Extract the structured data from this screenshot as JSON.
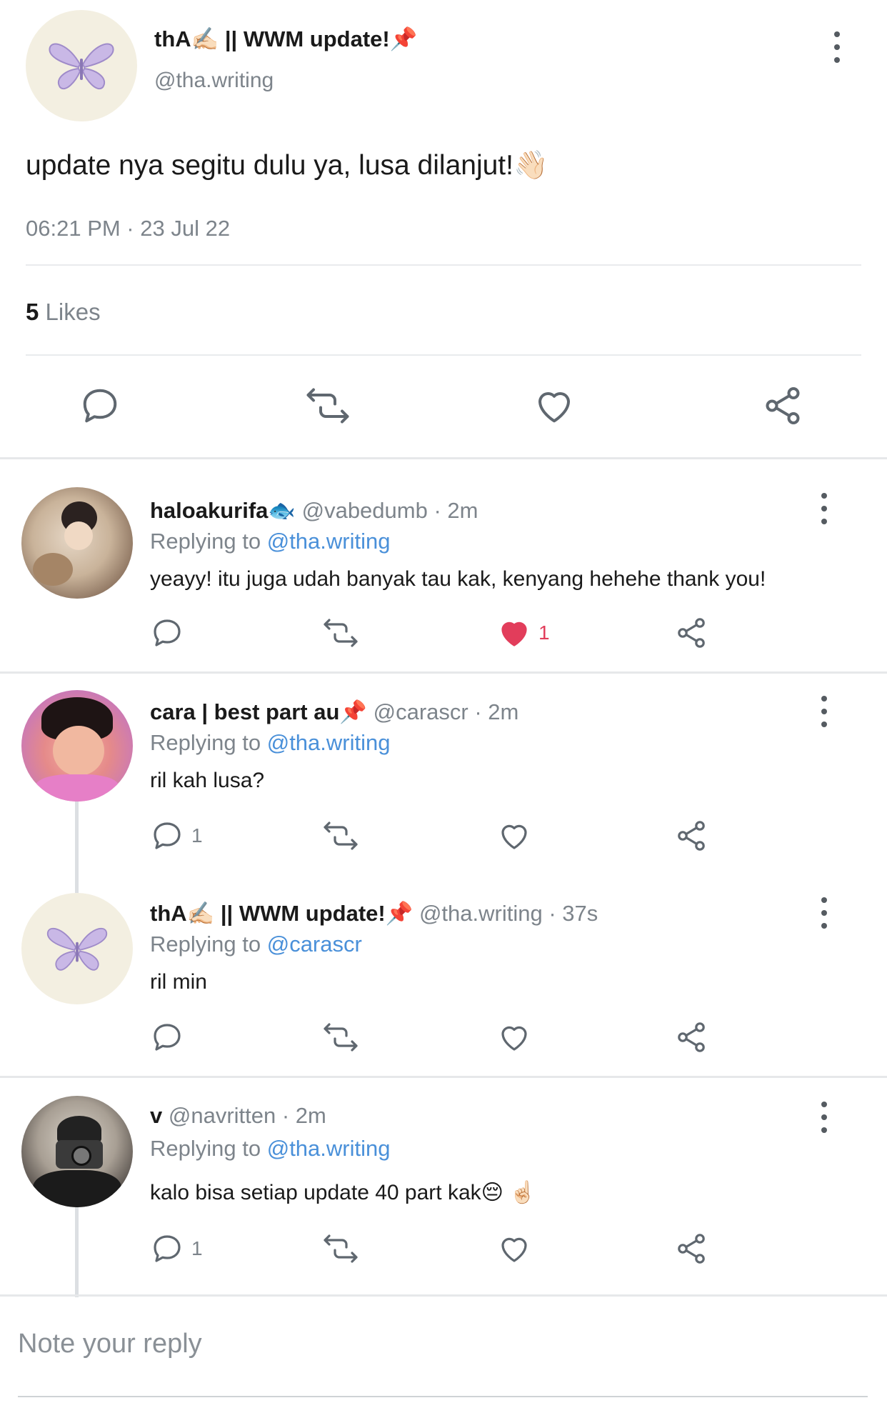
{
  "main_post": {
    "author_name": "thA✍🏻 || WWM update!📌",
    "handle": "@tha.writing",
    "text": "update nya segitu dulu ya, lusa dilanjut!👋🏻",
    "timestamp": "06:21 PM · 23 Jul 22",
    "likes_count": "5",
    "likes_label": "Likes"
  },
  "replies": [
    {
      "name": "haloakurifa🐟",
      "handle": "@vabedumb",
      "time": "· 2m",
      "replying_prefix": "Replying to",
      "replying_to": "@tha.writing",
      "text": "yeayy! itu juga udah banyak tau kak, kenyang hehehe thank you!",
      "comment_count": "",
      "like_count": "1",
      "liked": true
    },
    {
      "name": "cara | best part au📌",
      "handle": "@carascr",
      "time": "· 2m",
      "replying_prefix": "Replying to",
      "replying_to": "@tha.writing",
      "text": "ril kah lusa?",
      "comment_count": "1",
      "like_count": "",
      "liked": false
    },
    {
      "name": "thA✍🏻 || WWM update!📌",
      "handle": "@tha.writing",
      "time": "· 37s",
      "replying_prefix": "Replying to",
      "replying_to": "@carascr",
      "text": "ril min",
      "comment_count": "",
      "like_count": "",
      "liked": false
    },
    {
      "name": "v",
      "handle": "@navritten",
      "time": "· 2m",
      "replying_prefix": "Replying to",
      "replying_to": "@tha.writing",
      "text": "kalo bisa setiap update 40 part kak😔 ☝🏻",
      "comment_count": "1",
      "like_count": "",
      "liked": false
    }
  ],
  "reply_input": {
    "placeholder": "Note your reply"
  },
  "icons": [
    "butterfly-icon",
    "comment-icon",
    "retweet-icon",
    "heart-icon",
    "share-icon",
    "more-menu-icon"
  ],
  "colors": {
    "link": "#4a90d9",
    "like_red": "#e23d5b",
    "muted": "#7d848b",
    "avatar_bg": "#f3efe1"
  }
}
